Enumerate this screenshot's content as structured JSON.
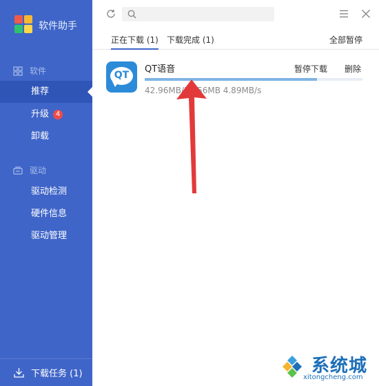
{
  "app": {
    "title": "软件助手"
  },
  "sidebar": {
    "sections": [
      {
        "label": "软件",
        "icon": "grid-icon",
        "items": [
          {
            "label": "推荐",
            "active": true
          },
          {
            "label": "升级",
            "badge": "4"
          },
          {
            "label": "卸载"
          }
        ]
      },
      {
        "label": "驱动",
        "icon": "drive-icon",
        "items": [
          {
            "label": "驱动检测"
          },
          {
            "label": "硬件信息"
          },
          {
            "label": "驱动管理"
          }
        ]
      }
    ],
    "footer": {
      "label": "下载任务 (1)",
      "icon": "download-icon"
    }
  },
  "topbar": {
    "search_placeholder": "",
    "icons": [
      "refresh-icon",
      "search-icon",
      "menu-icon",
      "close-icon"
    ]
  },
  "tabs": [
    {
      "label": "正在下载 (1)",
      "active": true
    },
    {
      "label": "下载完成 (1)",
      "active": false
    }
  ],
  "pause_all_label": "全部暂停",
  "downloads": [
    {
      "name": "QT语音",
      "icon_text": "QT",
      "pause_label": "暂停下载",
      "delete_label": "删除",
      "stats": "42.96MB/54.56MB  4.89MB/s",
      "progress": 0.79
    }
  ],
  "colors": {
    "sidebar": "#3f65c8",
    "sidebar_active": "#2f55b6",
    "accent": "#3f65c8",
    "progress": "#7fb5e3",
    "badge": "#ee4b4b",
    "arrow": "#e23a3a"
  },
  "watermark": {
    "text": "系统城",
    "url": "xitongcheng.com"
  }
}
